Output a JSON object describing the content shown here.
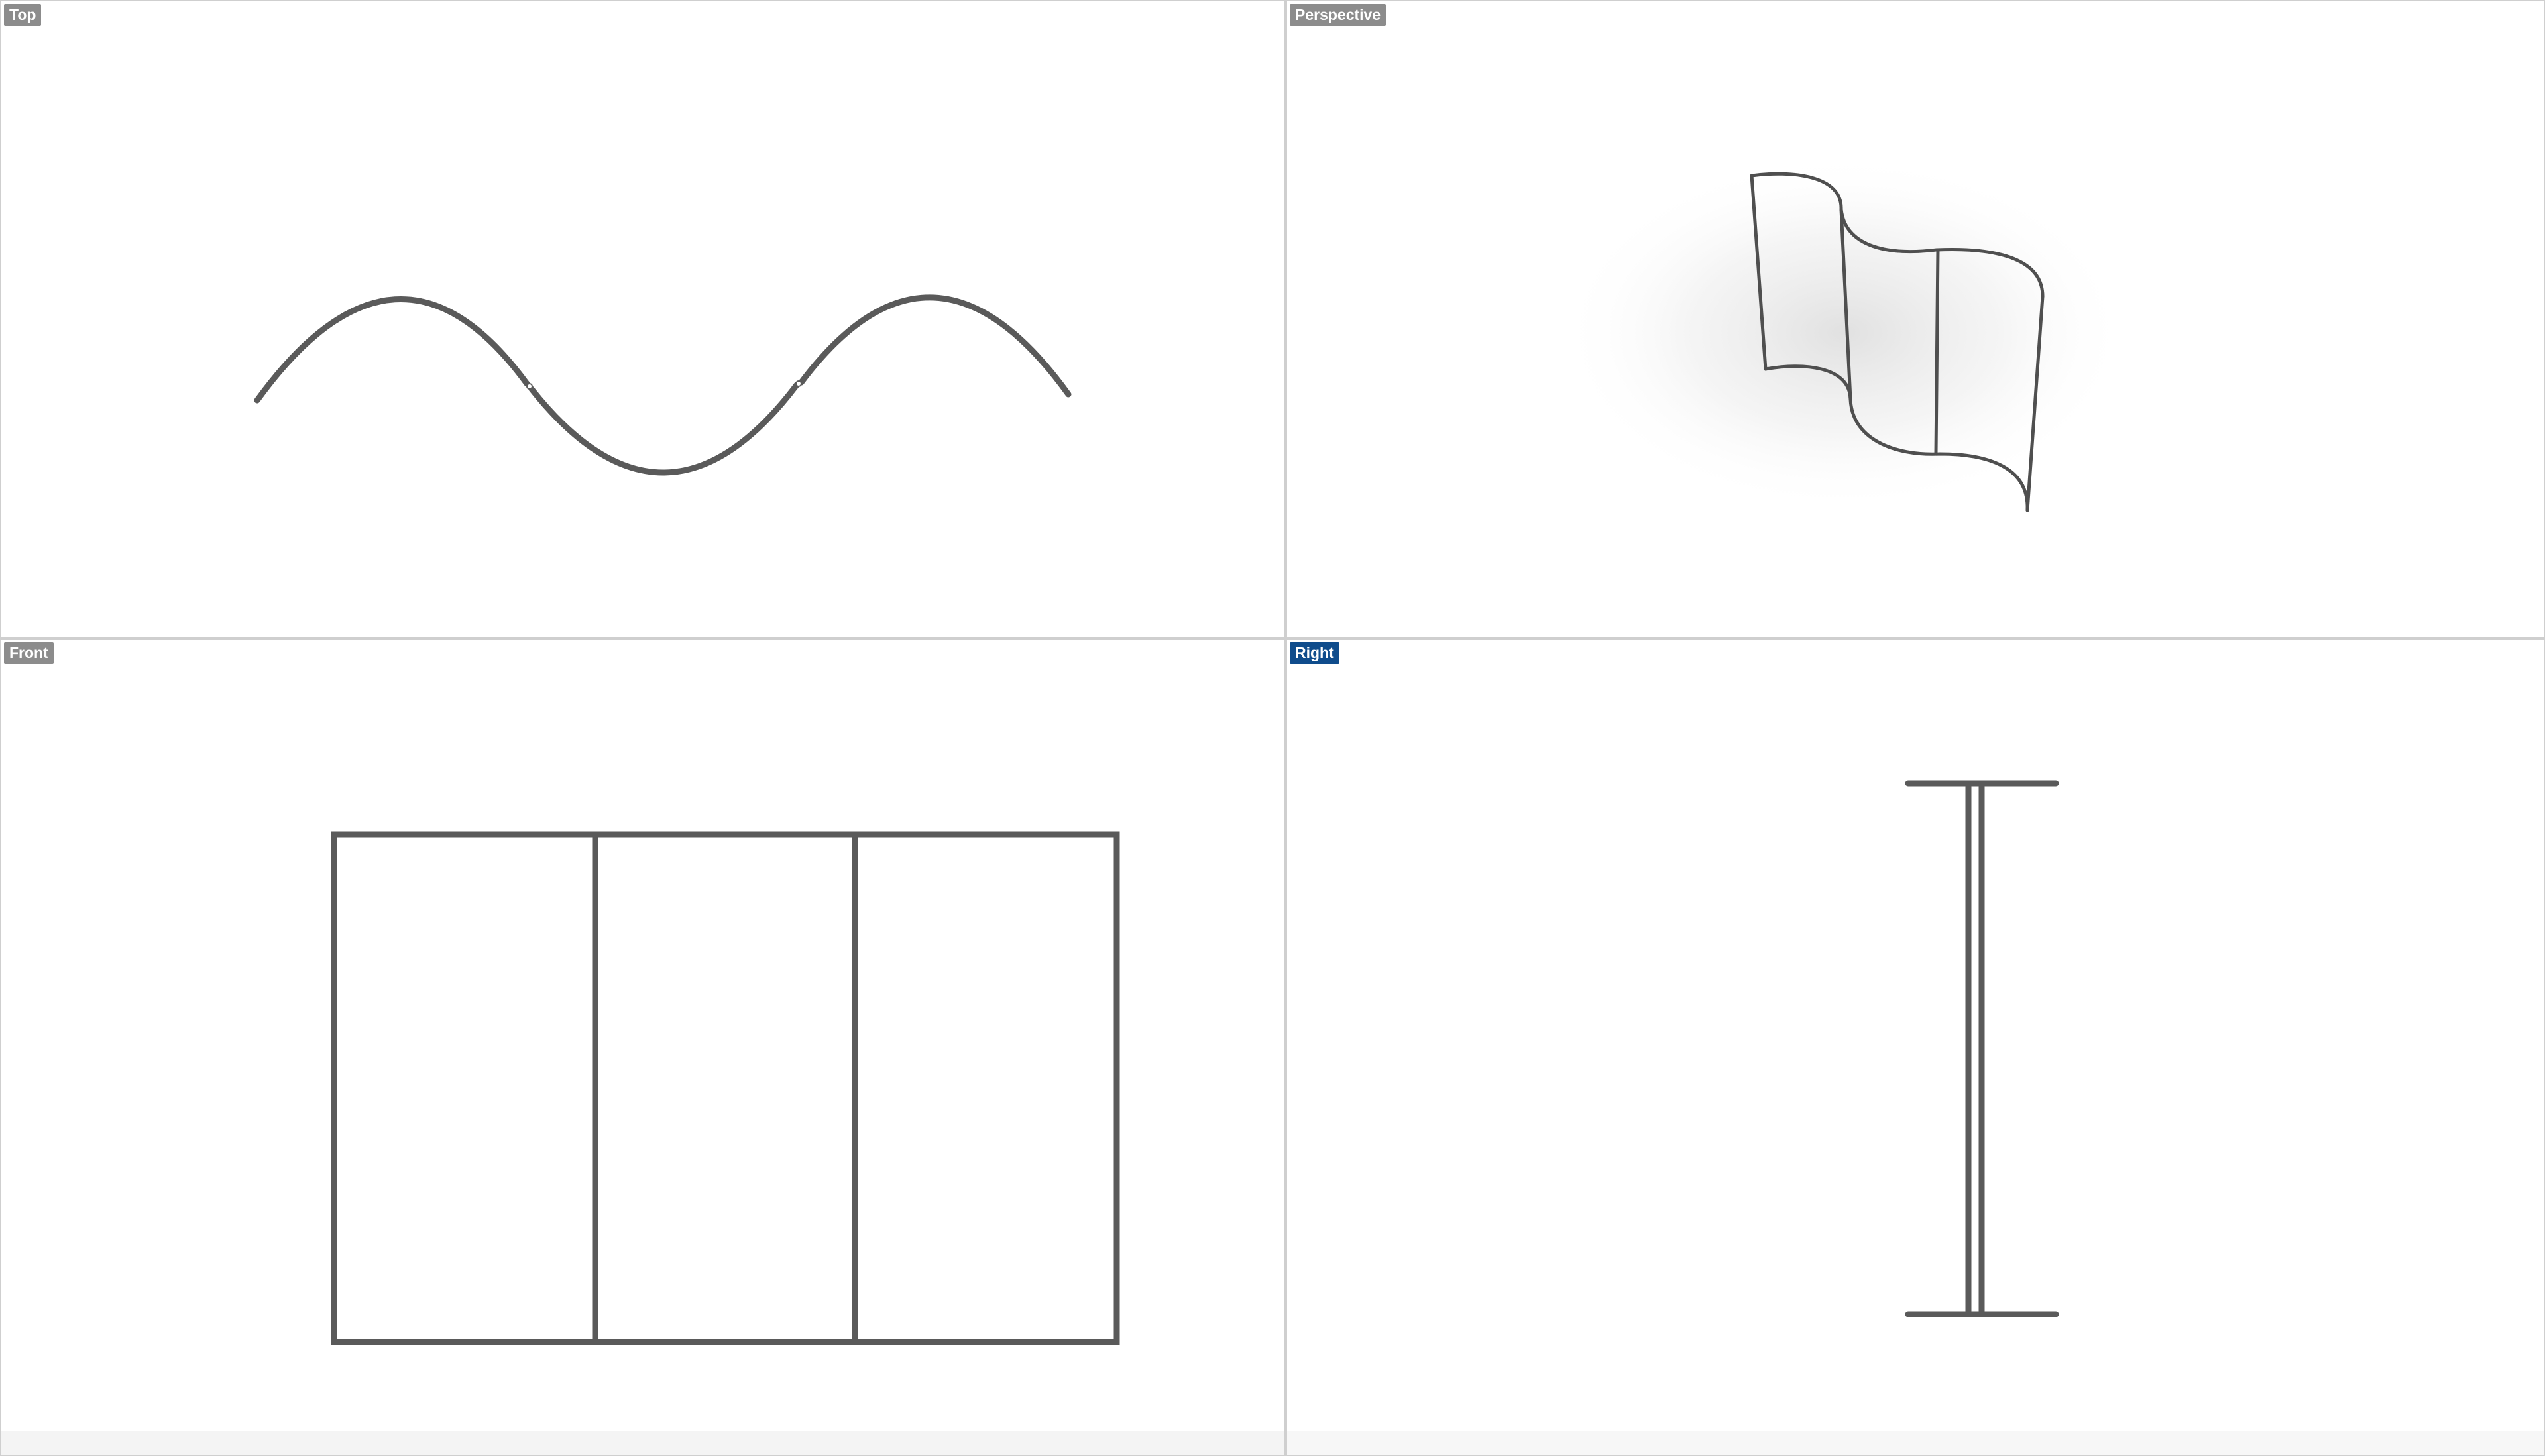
{
  "viewports": {
    "top": {
      "label": "Top",
      "active": false
    },
    "perspective": {
      "label": "Perspective",
      "active": false
    },
    "front": {
      "label": "Front",
      "active": false
    },
    "right": {
      "label": "Right",
      "active": true
    }
  },
  "colors": {
    "curve": "#5a5a5a",
    "background": "#ffffff",
    "divider": "#cfcfcf",
    "label_inactive": "#8c8c8c",
    "label_active": "#0f4c8c"
  }
}
